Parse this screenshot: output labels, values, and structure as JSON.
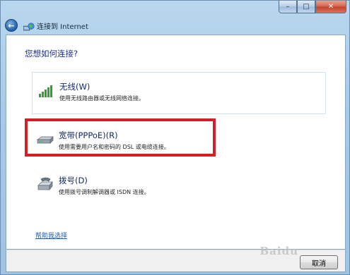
{
  "window": {
    "title": "连接到 Internet",
    "minimize_glyph": "–",
    "maximize_glyph": "□",
    "close_glyph": "✕"
  },
  "question": "您想如何连接?",
  "options": [
    {
      "title": "无线(W)",
      "description": "使用无线路由器或无线网络连接。",
      "icon": "wireless-signal-icon"
    },
    {
      "title": "宽带(PPPoE)(R)",
      "description": "使用需要用户名和密码的 DSL 或电缆连接。",
      "icon": "broadband-modem-icon"
    },
    {
      "title": "拨号(D)",
      "description": "使用拨号调制解调器或 ISDN 连接。",
      "icon": "dialup-modem-icon"
    }
  ],
  "help_link": "帮助我选择",
  "cancel_label": "取消",
  "watermark": "Baidu",
  "colors": {
    "highlight": "#d51f25",
    "link": "#1d5fae",
    "heading": "#1e3287"
  }
}
